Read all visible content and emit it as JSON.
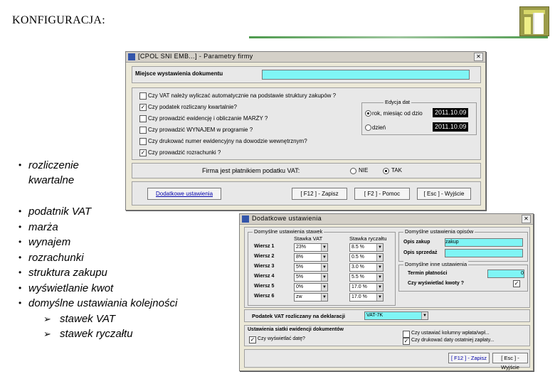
{
  "slide": {
    "title": "KONFIGURACJA:",
    "bullet_top": "rozliczenie kwartalne",
    "bullets": [
      "podatnik VAT",
      "marża",
      "wynajem",
      "rozrachunki",
      "struktura zakupu",
      "wyświetlanie kwot",
      "domyślne ustawiania kolejności"
    ],
    "subbullets": [
      "stawek VAT",
      "stawek ryczałtu"
    ]
  },
  "window1": {
    "title": "[CPOL SNI EMB...] - Parametry firmy",
    "location_label": "Miejsce wystawienia dokumentu",
    "location_value": "",
    "checkboxes": [
      {
        "label": "Czy VAT należy wyliczać automatycznie na podstawie struktury zakupów ?",
        "checked": false
      },
      {
        "label": "Czy podatek rozliczany kwartalnie?",
        "checked": true
      },
      {
        "label": "Czy prowadzić ewidencję i obliczanie MARŻY ?",
        "checked": false
      },
      {
        "label": "Czy prowadzić WYNAJEM w programie ?",
        "checked": false
      },
      {
        "label": "Czy drukować numer ewidencyjny na dowodzie wewnętrznym?",
        "checked": false
      },
      {
        "label": "Czy prowadzić rozrachunki ?",
        "checked": true
      }
    ],
    "dates_group": "Edycja dat",
    "date_opt1": "rok, miesiąc od dzio",
    "date_opt2": "dzień",
    "date1": "2011.10.09",
    "date2": "2011.10.09",
    "vat_payer_label": "Firma jest płatnikiem podatku VAT:",
    "opt_no": "NIE",
    "opt_yes": "TAK",
    "btn_extra": "Dodatkowe ustawienia",
    "btn_save": "[ F12 ] - Zapisz",
    "btn_help": "[ F2 ] - Pomoc",
    "btn_exit": "[ Esc ] - Wyjście"
  },
  "window2": {
    "title": "Dodatkowe ustawienia",
    "rates_group": "Domyślne ustawienia stawek",
    "col_vat": "Stawka VAT",
    "col_ryczalt": "Stawka ryczałtu",
    "rows": [
      {
        "label": "Wiersz 1",
        "vat": "23%",
        "ryczalt": "8.5 %"
      },
      {
        "label": "Wiersz 2",
        "vat": "8%",
        "ryczalt": "0.5 %"
      },
      {
        "label": "Wiersz 3",
        "vat": "5%",
        "ryczalt": "3.0 %"
      },
      {
        "label": "Wiersz 4",
        "vat": "5%",
        "ryczalt": "5.5 %"
      },
      {
        "label": "Wiersz 5",
        "vat": "0%",
        "ryczalt": "17.0 %"
      },
      {
        "label": "Wiersz 6",
        "vat": "zw",
        "ryczalt": "17.0 %"
      }
    ],
    "desc_group": "Domyślne ustawienia opisów",
    "desc_buy_label": "Opis zakup",
    "desc_buy_value": "zakup",
    "desc_sell_label": "Opis sprzedaż",
    "desc_sell_value": "",
    "other_group": "Domyślne inne ustawienia",
    "term_label": "Termin płatności",
    "term_value": "0",
    "show_amounts_label": "Czy wyświetlać kwoty ?",
    "vat_decl_label": "Podatek VAT rozliczany na deklaracji",
    "vat_decl_value": "VAT-7K",
    "reg_group": "Ustawienia siatki ewidencji dokumentów",
    "reg_cb1": "Czy wyświetlać datę?",
    "reg_cb2": "Czy ustawiać kolumny wpłata/wpł...",
    "reg_cb3": "Czy drukować daty ostatniej zapłaty...",
    "btn_save": "[ F12 ] - Zapisz",
    "btn_exit": "[ Esc ] - Wyjście"
  }
}
